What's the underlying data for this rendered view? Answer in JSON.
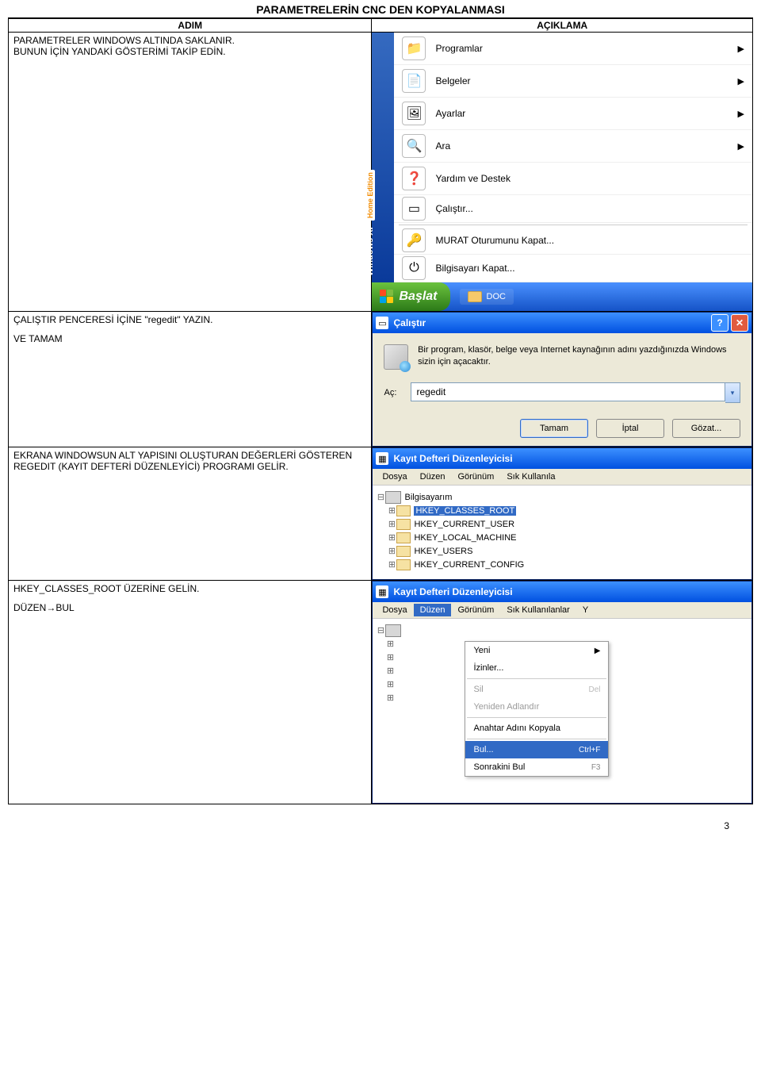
{
  "doc": {
    "title": "PARAMETRELERİN CNC DEN KOPYALANMASI",
    "col_step": "ADIM",
    "col_desc": "AÇIKLAMA",
    "page_number": "3"
  },
  "step1": {
    "line1": "PARAMETRELER WINDOWS  ALTINDA SAKLANIR.",
    "line2": "BUNUN İÇİN YANDAKİ GÖSTERİMİ TAKİP EDİN."
  },
  "startmenu": {
    "os_brand": "Windows XP",
    "os_edition": "Home Edition",
    "items": [
      {
        "icon": "📁",
        "label": "Programlar",
        "arrow": true
      },
      {
        "icon": "📄",
        "label": "Belgeler",
        "arrow": true
      },
      {
        "icon": "🖼",
        "label": "Ayarlar",
        "arrow": true
      },
      {
        "icon": "🔍",
        "label": "Ara",
        "arrow": true
      },
      {
        "icon": "❓",
        "label": "Yardım ve Destek",
        "arrow": false
      },
      {
        "icon": "▭",
        "label": "Çalıştır...",
        "arrow": false
      },
      {
        "icon": "🔑",
        "label": "MURAT Oturumunu Kapat...",
        "arrow": false
      },
      {
        "icon": "⏻",
        "label": "Bilgisayarı Kapat...",
        "arrow": false
      }
    ],
    "start_label": "Başlat",
    "task_label": "DOC"
  },
  "step2": {
    "line1": "ÇALIŞTIR PENCERESİ İÇİNE \"regedit\" YAZIN.",
    "line2": "VE TAMAM"
  },
  "rundlg": {
    "title": "Çalıştır",
    "desc": "Bir program, klasör, belge veya Internet kaynağının adını yazdığınızda Windows sizin için açacaktır.",
    "open_label": "Aç:",
    "value": "regedit",
    "btn_ok": "Tamam",
    "btn_cancel": "İptal",
    "btn_browse": "Gözat..."
  },
  "step3": {
    "text": "EKRANA WINDOWSUN ALT YAPISINI OLUŞTURAN DEĞERLERİ GÖSTEREN REGEDIT (KAYIT DEFTERİ DÜZENLEYİCİ) PROGRAMI GELİR."
  },
  "regedit1": {
    "title": "Kayıt Defteri Düzenleyicisi",
    "menu": [
      "Dosya",
      "Düzen",
      "Görünüm",
      "Sık Kullanıla"
    ],
    "root": "Bilgisayarım",
    "keys": [
      "HKEY_CLASSES_ROOT",
      "HKEY_CURRENT_USER",
      "HKEY_LOCAL_MACHINE",
      "HKEY_USERS",
      "HKEY_CURRENT_CONFIG"
    ],
    "selected": 0
  },
  "step4": {
    "line1": "HKEY_CLASSES_ROOT  ÜZERİNE GELİN.",
    "line2": "DÜZEN→BUL"
  },
  "regedit2": {
    "title": "Kayıt Defteri Düzenleyicisi",
    "menu": [
      "Dosya",
      "Düzen",
      "Görünüm",
      "Sık Kullanılanlar",
      "Y"
    ],
    "menu_hl": 1,
    "ctx": [
      {
        "label": "Yeni",
        "sc": "",
        "arrow": true,
        "dis": false
      },
      {
        "label": "İzinler...",
        "sc": "",
        "dis": false
      },
      {
        "sep": true
      },
      {
        "label": "Sil",
        "sc": "Del",
        "dis": true
      },
      {
        "label": "Yeniden Adlandır",
        "sc": "",
        "dis": true
      },
      {
        "sep": true
      },
      {
        "label": "Anahtar Adını Kopyala",
        "sc": "",
        "dis": false
      },
      {
        "sep": true
      },
      {
        "label": "Bul...",
        "sc": "Ctrl+F",
        "sel": true
      },
      {
        "label": "Sonrakini Bul",
        "sc": "F3",
        "dis": false
      }
    ]
  }
}
